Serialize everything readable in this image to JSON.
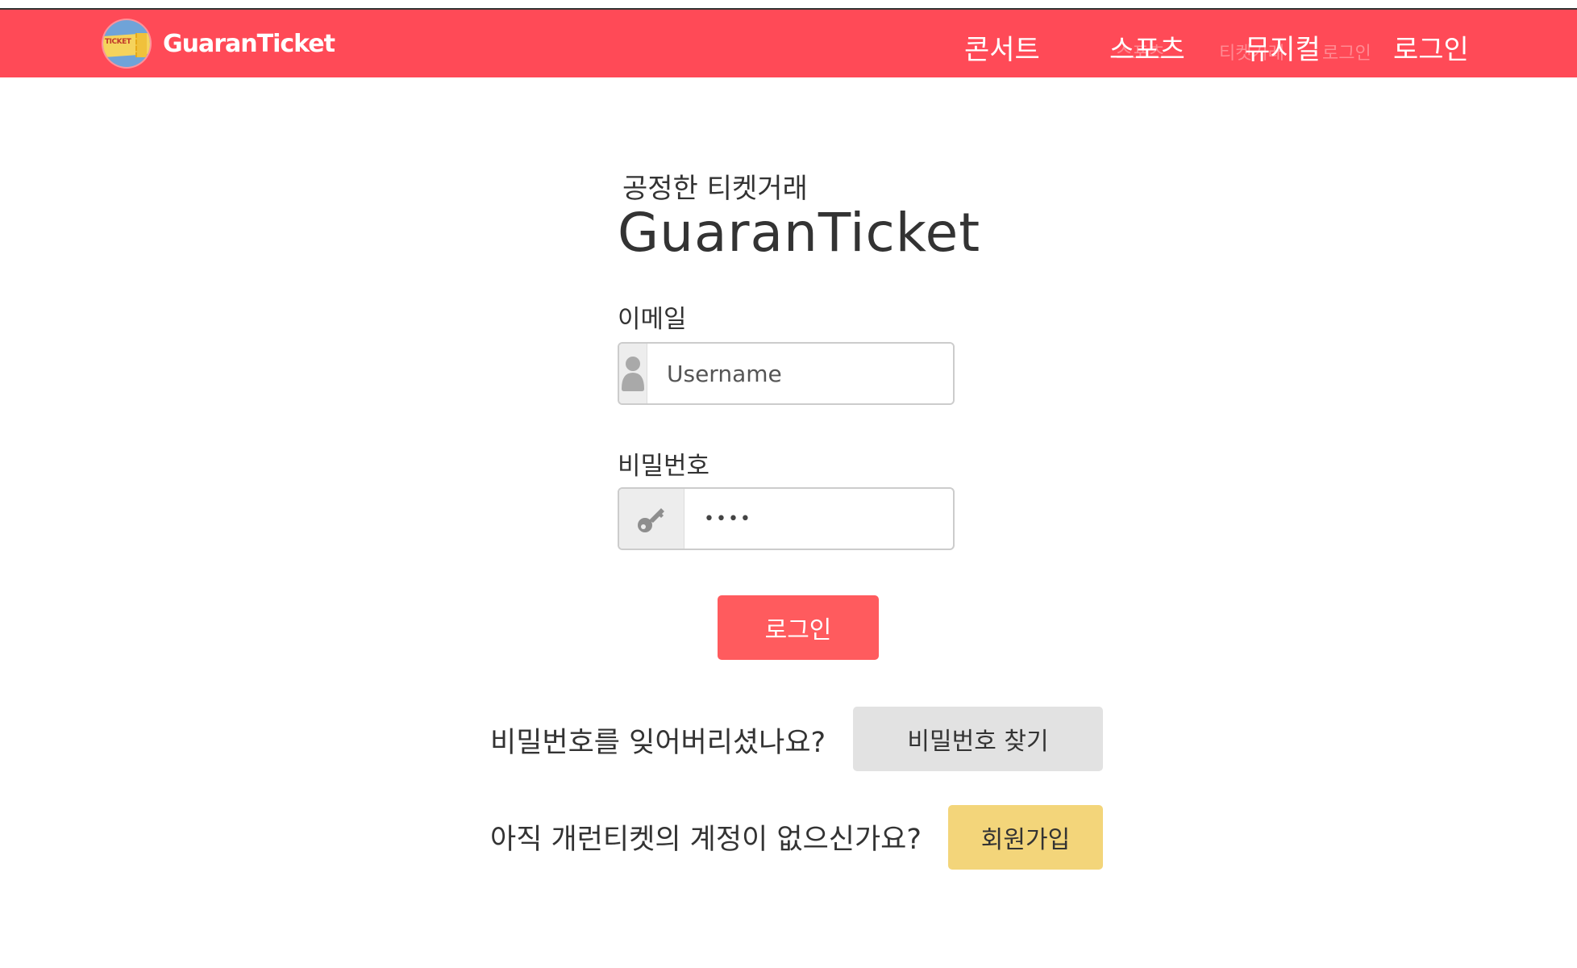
{
  "navbar": {
    "brand_name": "GuaranTicket",
    "logo_text": "TICKET",
    "background_color": "#ff4a57",
    "links": {
      "concert": "콘서트",
      "sports": "스포츠",
      "musical": "뮤지컬",
      "login": "로그인"
    },
    "ghost_text": {
      "a": "스포츠",
      "b": "티켓거래",
      "c": "로그인"
    }
  },
  "login_form": {
    "subtitle": "공정한 티켓거래",
    "title": "GuaranTicket",
    "email_label": "이메일",
    "email_placeholder": "Username",
    "email_icon": "user-icon",
    "password_label": "비밀번호",
    "password_value": "••••",
    "password_icon": "key-icon",
    "login_button": "로그인",
    "login_button_color": "#ff5b5e"
  },
  "forgot_password": {
    "prompt": "비밀번호를 잊어버리셨나요?",
    "button": "비밀번호 찾기",
    "button_color": "#e2e2e2"
  },
  "signup": {
    "prompt": "아직 개런티켓의 계정이 없으신가요?",
    "button": "회원가입",
    "button_color": "#f3d57a"
  }
}
